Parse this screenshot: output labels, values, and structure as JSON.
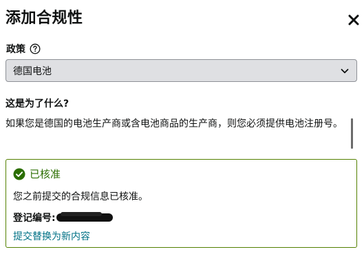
{
  "dialog": {
    "title": "添加合规性",
    "close_icon": "close-icon"
  },
  "policy": {
    "label": "政策",
    "help_icon": "question-circle-icon",
    "selected": "德国电池",
    "dropdown_icon": "chevron-down-icon"
  },
  "question": {
    "heading": "这是为了什么?",
    "description": "如果您是德国的电池生产商或含电池商品的生产商，则您必须提供电池注册号。"
  },
  "status": {
    "icon": "check-circle-icon",
    "label": "已核准",
    "message": "您之前提交的合规信息已核准。",
    "reg_label": "登记编号:",
    "link_label": "提交替换为新内容",
    "colors": {
      "success": "#2b6e00",
      "border": "#538000",
      "link": "#007185"
    }
  }
}
